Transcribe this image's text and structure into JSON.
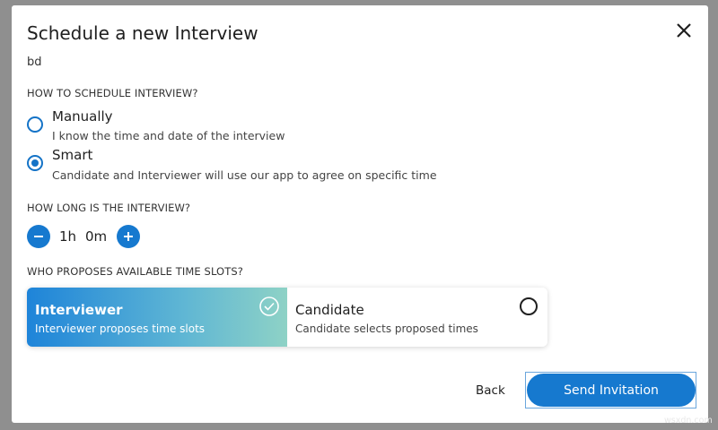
{
  "dialog": {
    "title": "Schedule a new Interview",
    "subtitle": "bd",
    "close_icon": "close-icon"
  },
  "how_to_schedule": {
    "label": "HOW TO SCHEDULE INTERVIEW?",
    "options": [
      {
        "title": "Manually",
        "description": "I know the time and date of the interview",
        "selected": false
      },
      {
        "title": "Smart",
        "description": "Candidate and Interviewer will use our app to agree on specific time",
        "selected": true
      }
    ]
  },
  "duration": {
    "label": "HOW LONG IS THE INTERVIEW?",
    "hours": "1h",
    "minutes": "0m",
    "decrement_icon": "minus-icon",
    "increment_icon": "plus-icon"
  },
  "proposer": {
    "label": "WHO PROPOSES AVAILABLE TIME SLOTS?",
    "options": [
      {
        "title": "Interviewer",
        "description": "Interviewer proposes time slots",
        "selected": true
      },
      {
        "title": "Candidate",
        "description": "Candidate selects proposed times",
        "selected": false
      }
    ]
  },
  "footer": {
    "back_label": "Back",
    "send_label": "Send Invitation"
  },
  "watermark": "wsxdn.com",
  "colors": {
    "accent": "#1679cf",
    "gradient_start": "#1e84d9",
    "gradient_end": "#8ed2c6"
  }
}
